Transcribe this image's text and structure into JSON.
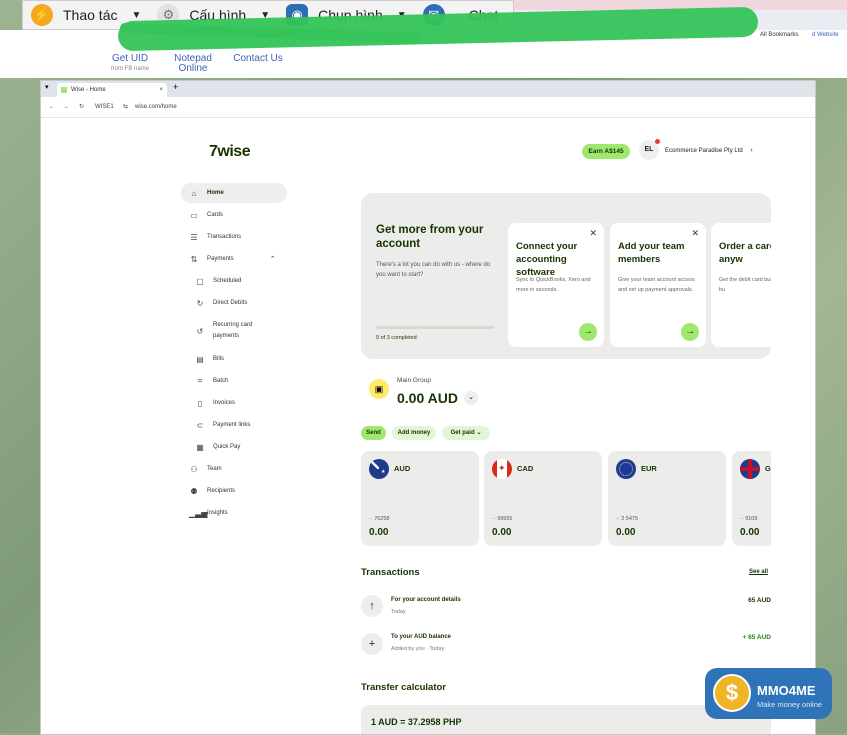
{
  "remote_toolbar": {
    "items": [
      {
        "label": "Thao tác",
        "icon": "lightning-icon"
      },
      {
        "label": "Cấu hình",
        "icon": "gear-icon"
      },
      {
        "label": "Chụp hình",
        "icon": "camera-icon"
      },
      {
        "label": "Chat",
        "icon": "chat-icon"
      }
    ]
  },
  "remote_links": [
    {
      "label": "Get UID",
      "sub": "from FB name"
    },
    {
      "label": "Notepad Online",
      "sub": ""
    },
    {
      "label": "Contact Us",
      "sub": ""
    }
  ],
  "remote_bookmarks": {
    "all_bookmarks": "All Bookmarks",
    "website": "d Website"
  },
  "browser": {
    "tab_title": "Wise - Home",
    "address": "wise.com/home",
    "site_label": "WISE1"
  },
  "header": {
    "logo": "7wise",
    "earn": "Earn A$145",
    "avatar_initials": "EL",
    "company": "Ecommerce Paradise Pty Ltd"
  },
  "nav": [
    {
      "label": "Home",
      "icon": "home-icon",
      "sub": false,
      "active": true
    },
    {
      "label": "Cards",
      "icon": "card-icon",
      "sub": false
    },
    {
      "label": "Transactions",
      "icon": "list-icon",
      "sub": false
    },
    {
      "label": "Payments",
      "icon": "payments-icon",
      "sub": false,
      "expanded": true
    },
    {
      "label": "Scheduled",
      "icon": "calendar-icon",
      "sub": true
    },
    {
      "label": "Direct Debits",
      "icon": "refresh-icon",
      "sub": true
    },
    {
      "label": "Recurring card payments",
      "icon": "recurring-icon",
      "sub": true
    },
    {
      "label": "Bills",
      "icon": "bill-icon",
      "sub": true
    },
    {
      "label": "Batch",
      "icon": "batch-icon",
      "sub": true
    },
    {
      "label": "Invoices",
      "icon": "invoice-icon",
      "sub": true
    },
    {
      "label": "Payment links",
      "icon": "link-icon",
      "sub": true
    },
    {
      "label": "Quick Pay",
      "icon": "qr-icon",
      "sub": true
    },
    {
      "label": "Team",
      "icon": "team-icon",
      "sub": false
    },
    {
      "label": "Recipients",
      "icon": "recipients-icon",
      "sub": false
    },
    {
      "label": "Insights",
      "icon": "chart-icon",
      "sub": false
    }
  ],
  "promo": {
    "title": "Get more from your account",
    "text": "There's a lot you can do with us - where do you want to start?",
    "progress_text": "0 of 3 completed",
    "progress": 0,
    "cards": [
      {
        "title": "Connect your accounting software",
        "text": "Sync to QuickBooks, Xero and more in seconds."
      },
      {
        "title": "Add your team members",
        "text": "Give your team account access and set up payment approvals."
      },
      {
        "title": "Order a card spend anyw",
        "text": "Get the debit card built for global bu"
      }
    ]
  },
  "group": {
    "name": "Main Group",
    "balance": "0.00 AUD"
  },
  "actions": {
    "send": "Send",
    "add_money": "Add money",
    "get_paid": "Get paid"
  },
  "currencies": [
    {
      "code": "AUD",
      "account": "·· 76258",
      "balance": "0.00",
      "flag": "australia-flag-icon"
    },
    {
      "code": "CAD",
      "account": "·· 99955",
      "balance": "0.00",
      "flag": "canada-flag-icon"
    },
    {
      "code": "EUR",
      "account": "·· 2 5475",
      "balance": "0.00",
      "flag": "eu-flag-icon"
    },
    {
      "code": "G",
      "account": "·· 9109",
      "balance": "0.00",
      "flag": "uk-flag-icon"
    }
  ],
  "transactions": {
    "title": "Transactions",
    "see_all": "See all",
    "items": [
      {
        "title": "For your account details",
        "sub": "Today",
        "amount": "65 AUD",
        "icon": "arrow-up-icon"
      },
      {
        "title": "To your AUD balance",
        "sub": "Added by you · Today",
        "amount": "+ 65 AUD",
        "icon": "plus-icon"
      }
    ]
  },
  "calculator": {
    "title": "Transfer calculator",
    "rate": "1 AUD = 37.2958 PHP"
  },
  "watermark": {
    "title": "MMO4ME",
    "subtitle": "Make money online"
  },
  "colors": {
    "wise_green": "#9fe870",
    "wise_forest": "#163300",
    "scribble": "#34c459"
  }
}
